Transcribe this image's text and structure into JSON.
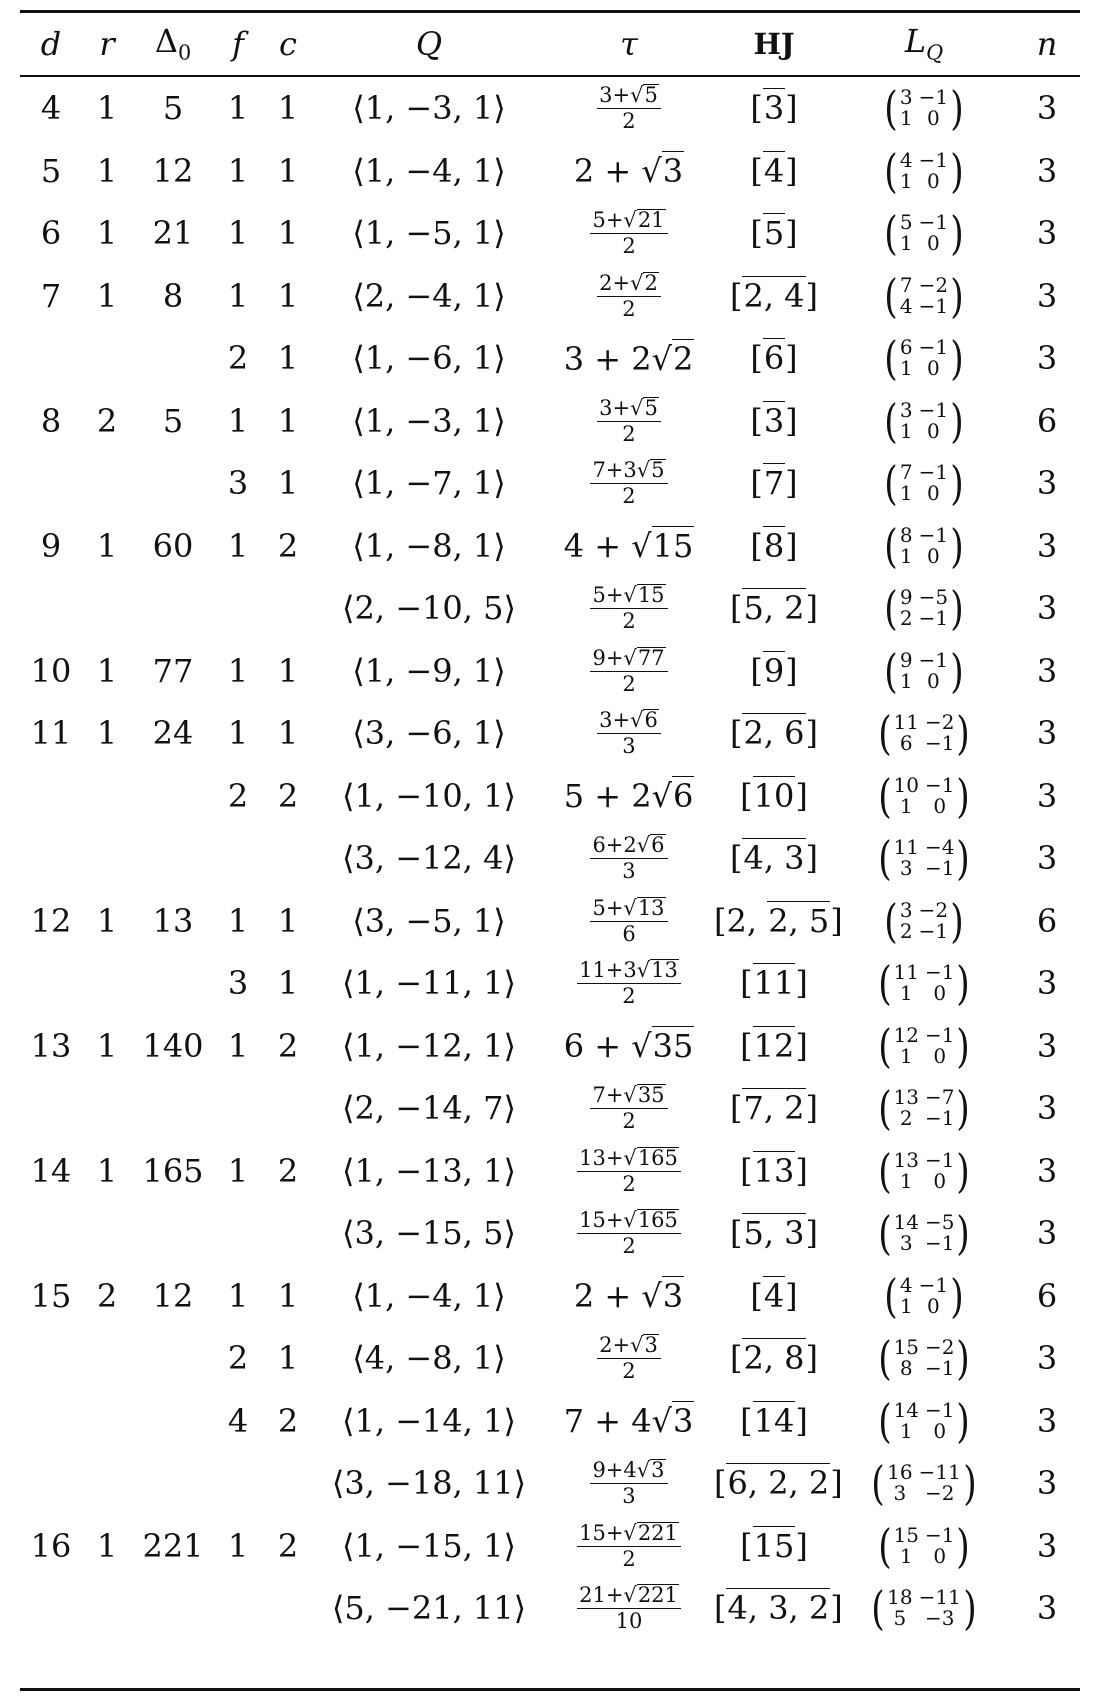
{
  "headers": {
    "d": "d",
    "r": "r",
    "delta": "Δ",
    "delta_sub": "0",
    "f": "f",
    "c": "c",
    "Q": "Q",
    "tau": "τ",
    "HJ": "HJ",
    "L": "L",
    "L_sub": "Q",
    "n": "n"
  },
  "rows": [
    {
      "d": "4",
      "r": "1",
      "delta": "5",
      "f": "1",
      "c": "1",
      "Q": "⟨1, −3, 1⟩",
      "tau": {
        "type": "frac",
        "num": {
          "pre": "3+",
          "coef": "",
          "rad": "5"
        },
        "den": "2"
      },
      "hj": {
        "pre": "",
        "per": "3"
      },
      "L": [
        "3",
        "−1",
        "1",
        "0"
      ],
      "n": "3"
    },
    {
      "d": "5",
      "r": "1",
      "delta": "12",
      "f": "1",
      "c": "1",
      "Q": "⟨1, −4, 1⟩",
      "tau": {
        "type": "inline",
        "pre": "2 + ",
        "coef": "",
        "rad": "3"
      },
      "hj": {
        "pre": "",
        "per": "4"
      },
      "L": [
        "4",
        "−1",
        "1",
        "0"
      ],
      "n": "3"
    },
    {
      "d": "6",
      "r": "1",
      "delta": "21",
      "f": "1",
      "c": "1",
      "Q": "⟨1, −5, 1⟩",
      "tau": {
        "type": "frac",
        "num": {
          "pre": "5+",
          "coef": "",
          "rad": "21"
        },
        "den": "2"
      },
      "hj": {
        "pre": "",
        "per": "5"
      },
      "L": [
        "5",
        "−1",
        "1",
        "0"
      ],
      "n": "3"
    },
    {
      "d": "7",
      "r": "1",
      "delta": "8",
      "f": "1",
      "c": "1",
      "Q": "⟨2, −4, 1⟩",
      "tau": {
        "type": "frac",
        "num": {
          "pre": "2+",
          "coef": "",
          "rad": "2"
        },
        "den": "2"
      },
      "hj": {
        "pre": "",
        "per": "2, 4"
      },
      "L": [
        "7",
        "−2",
        "4",
        "−1"
      ],
      "n": "3"
    },
    {
      "d": "",
      "r": "",
      "delta": "",
      "f": "2",
      "c": "1",
      "Q": "⟨1, −6, 1⟩",
      "tau": {
        "type": "inline",
        "pre": "3 + ",
        "coef": "2",
        "rad": "2"
      },
      "hj": {
        "pre": "",
        "per": "6"
      },
      "L": [
        "6",
        "−1",
        "1",
        "0"
      ],
      "n": "3"
    },
    {
      "d": "8",
      "r": "2",
      "delta": "5",
      "f": "1",
      "c": "1",
      "Q": "⟨1, −3, 1⟩",
      "tau": {
        "type": "frac",
        "num": {
          "pre": "3+",
          "coef": "",
          "rad": "5"
        },
        "den": "2"
      },
      "hj": {
        "pre": "",
        "per": "3"
      },
      "L": [
        "3",
        "−1",
        "1",
        "0"
      ],
      "n": "6"
    },
    {
      "d": "",
      "r": "",
      "delta": "",
      "f": "3",
      "c": "1",
      "Q": "⟨1, −7, 1⟩",
      "tau": {
        "type": "frac",
        "num": {
          "pre": "7+",
          "coef": "3",
          "rad": "5"
        },
        "den": "2"
      },
      "hj": {
        "pre": "",
        "per": "7"
      },
      "L": [
        "7",
        "−1",
        "1",
        "0"
      ],
      "n": "3"
    },
    {
      "d": "9",
      "r": "1",
      "delta": "60",
      "f": "1",
      "c": "2",
      "Q": "⟨1, −8, 1⟩",
      "tau": {
        "type": "inline",
        "pre": "4 + ",
        "coef": "",
        "rad": "15"
      },
      "hj": {
        "pre": "",
        "per": "8"
      },
      "L": [
        "8",
        "−1",
        "1",
        "0"
      ],
      "n": "3"
    },
    {
      "d": "",
      "r": "",
      "delta": "",
      "f": "",
      "c": "",
      "Q": "⟨2, −10, 5⟩",
      "tau": {
        "type": "frac",
        "num": {
          "pre": "5+",
          "coef": "",
          "rad": "15"
        },
        "den": "2"
      },
      "hj": {
        "pre": "",
        "per": "5, 2"
      },
      "L": [
        "9",
        "−5",
        "2",
        "−1"
      ],
      "n": "3"
    },
    {
      "d": "10",
      "r": "1",
      "delta": "77",
      "f": "1",
      "c": "1",
      "Q": "⟨1, −9, 1⟩",
      "tau": {
        "type": "frac",
        "num": {
          "pre": "9+",
          "coef": "",
          "rad": "77"
        },
        "den": "2"
      },
      "hj": {
        "pre": "",
        "per": "9"
      },
      "L": [
        "9",
        "−1",
        "1",
        "0"
      ],
      "n": "3"
    },
    {
      "d": "11",
      "r": "1",
      "delta": "24",
      "f": "1",
      "c": "1",
      "Q": "⟨3, −6, 1⟩",
      "tau": {
        "type": "frac",
        "num": {
          "pre": "3+",
          "coef": "",
          "rad": "6"
        },
        "den": "3"
      },
      "hj": {
        "pre": "",
        "per": "2, 6"
      },
      "L": [
        "11",
        "−2",
        "6",
        "−1"
      ],
      "n": "3"
    },
    {
      "d": "",
      "r": "",
      "delta": "",
      "f": "2",
      "c": "2",
      "Q": "⟨1, −10, 1⟩",
      "tau": {
        "type": "inline",
        "pre": "5 + ",
        "coef": "2",
        "rad": "6"
      },
      "hj": {
        "pre": "",
        "per": "10"
      },
      "L": [
        "10",
        "−1",
        "1",
        "0"
      ],
      "n": "3"
    },
    {
      "d": "",
      "r": "",
      "delta": "",
      "f": "",
      "c": "",
      "Q": "⟨3, −12, 4⟩",
      "tau": {
        "type": "frac",
        "num": {
          "pre": "6+",
          "coef": "2",
          "rad": "6"
        },
        "den": "3"
      },
      "hj": {
        "pre": "",
        "per": "4, 3"
      },
      "L": [
        "11",
        "−4",
        "3",
        "−1"
      ],
      "n": "3"
    },
    {
      "d": "12",
      "r": "1",
      "delta": "13",
      "f": "1",
      "c": "1",
      "Q": "⟨3, −5, 1⟩",
      "tau": {
        "type": "frac",
        "num": {
          "pre": "5+",
          "coef": "",
          "rad": "13"
        },
        "den": "6"
      },
      "hj": {
        "pre": "2, ",
        "per": "2, 5"
      },
      "L": [
        "3",
        "−2",
        "2",
        "−1"
      ],
      "n": "6"
    },
    {
      "d": "",
      "r": "",
      "delta": "",
      "f": "3",
      "c": "1",
      "Q": "⟨1, −11, 1⟩",
      "tau": {
        "type": "frac",
        "num": {
          "pre": "11+",
          "coef": "3",
          "rad": "13"
        },
        "den": "2"
      },
      "hj": {
        "pre": "",
        "per": "11"
      },
      "L": [
        "11",
        "−1",
        "1",
        "0"
      ],
      "n": "3"
    },
    {
      "d": "13",
      "r": "1",
      "delta": "140",
      "f": "1",
      "c": "2",
      "Q": "⟨1, −12, 1⟩",
      "tau": {
        "type": "inline",
        "pre": "6 + ",
        "coef": "",
        "rad": "35"
      },
      "hj": {
        "pre": "",
        "per": "12"
      },
      "L": [
        "12",
        "−1",
        "1",
        "0"
      ],
      "n": "3"
    },
    {
      "d": "",
      "r": "",
      "delta": "",
      "f": "",
      "c": "",
      "Q": "⟨2, −14, 7⟩",
      "tau": {
        "type": "frac",
        "num": {
          "pre": "7+",
          "coef": "",
          "rad": "35"
        },
        "den": "2"
      },
      "hj": {
        "pre": "",
        "per": "7, 2"
      },
      "L": [
        "13",
        "−7",
        "2",
        "−1"
      ],
      "n": "3"
    },
    {
      "d": "14",
      "r": "1",
      "delta": "165",
      "f": "1",
      "c": "2",
      "Q": "⟨1, −13, 1⟩",
      "tau": {
        "type": "frac",
        "num": {
          "pre": "13+",
          "coef": "",
          "rad": "165"
        },
        "den": "2"
      },
      "hj": {
        "pre": "",
        "per": "13"
      },
      "L": [
        "13",
        "−1",
        "1",
        "0"
      ],
      "n": "3"
    },
    {
      "d": "",
      "r": "",
      "delta": "",
      "f": "",
      "c": "",
      "Q": "⟨3, −15, 5⟩",
      "tau": {
        "type": "frac",
        "num": {
          "pre": "15+",
          "coef": "",
          "rad": "165"
        },
        "den": "2"
      },
      "hj": {
        "pre": "",
        "per": "5, 3"
      },
      "L": [
        "14",
        "−5",
        "3",
        "−1"
      ],
      "n": "3"
    },
    {
      "d": "15",
      "r": "2",
      "delta": "12",
      "f": "1",
      "c": "1",
      "Q": "⟨1, −4, 1⟩",
      "tau": {
        "type": "inline",
        "pre": "2 + ",
        "coef": "",
        "rad": "3"
      },
      "hj": {
        "pre": "",
        "per": "4"
      },
      "L": [
        "4",
        "−1",
        "1",
        "0"
      ],
      "n": "6"
    },
    {
      "d": "",
      "r": "",
      "delta": "",
      "f": "2",
      "c": "1",
      "Q": "⟨4, −8, 1⟩",
      "tau": {
        "type": "frac",
        "num": {
          "pre": "2+",
          "coef": "",
          "rad": "3"
        },
        "den": "2"
      },
      "hj": {
        "pre": "",
        "per": "2, 8"
      },
      "L": [
        "15",
        "−2",
        "8",
        "−1"
      ],
      "n": "3"
    },
    {
      "d": "",
      "r": "",
      "delta": "",
      "f": "4",
      "c": "2",
      "Q": "⟨1, −14, 1⟩",
      "tau": {
        "type": "inline",
        "pre": "7 + ",
        "coef": "4",
        "rad": "3"
      },
      "hj": {
        "pre": "",
        "per": "14"
      },
      "L": [
        "14",
        "−1",
        "1",
        "0"
      ],
      "n": "3"
    },
    {
      "d": "",
      "r": "",
      "delta": "",
      "f": "",
      "c": "",
      "Q": "⟨3, −18, 11⟩",
      "tau": {
        "type": "frac",
        "num": {
          "pre": "9+",
          "coef": "4",
          "rad": "3"
        },
        "den": "3"
      },
      "hj": {
        "pre": "",
        "per": "6, 2, 2"
      },
      "L": [
        "16",
        "−11",
        "3",
        "−2"
      ],
      "n": "3"
    },
    {
      "d": "16",
      "r": "1",
      "delta": "221",
      "f": "1",
      "c": "2",
      "Q": "⟨1, −15, 1⟩",
      "tau": {
        "type": "frac",
        "num": {
          "pre": "15+",
          "coef": "",
          "rad": "221"
        },
        "den": "2"
      },
      "hj": {
        "pre": "",
        "per": "15"
      },
      "L": [
        "15",
        "−1",
        "1",
        "0"
      ],
      "n": "3"
    },
    {
      "d": "",
      "r": "",
      "delta": "",
      "f": "",
      "c": "",
      "Q": "⟨5, −21, 11⟩",
      "tau": {
        "type": "frac",
        "num": {
          "pre": "21+",
          "coef": "",
          "rad": "221"
        },
        "den": "10"
      },
      "hj": {
        "pre": "",
        "per": "4, 3, 2"
      },
      "L": [
        "18",
        "−11",
        "5",
        "−3"
      ],
      "n": "3"
    }
  ]
}
